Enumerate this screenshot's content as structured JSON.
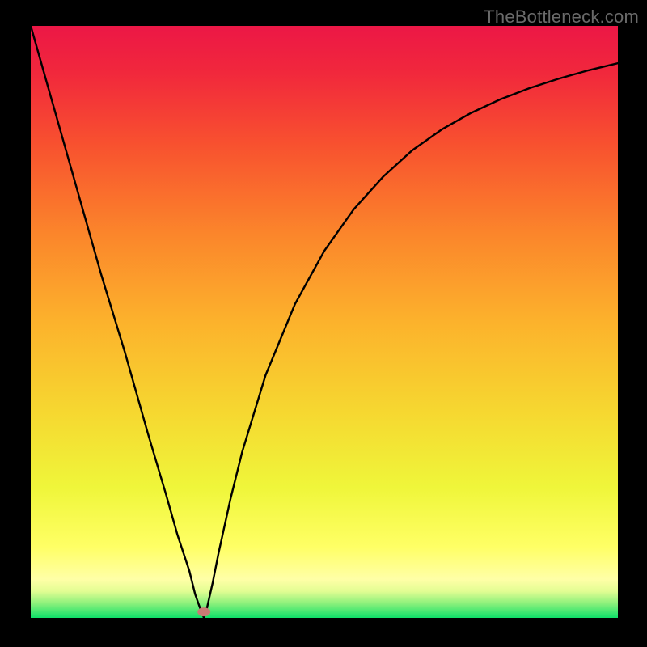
{
  "watermark": "TheBottleneck.com",
  "colors": {
    "bg": "#000000",
    "curve": "#000000",
    "dot": "#c97b74",
    "gradient_stops": [
      {
        "offset": 0.0,
        "color": "#ec1746"
      },
      {
        "offset": 0.08,
        "color": "#f1283c"
      },
      {
        "offset": 0.2,
        "color": "#f8512f"
      },
      {
        "offset": 0.35,
        "color": "#fb852b"
      },
      {
        "offset": 0.5,
        "color": "#fcb22c"
      },
      {
        "offset": 0.65,
        "color": "#f6d730"
      },
      {
        "offset": 0.78,
        "color": "#eff63a"
      },
      {
        "offset": 0.88,
        "color": "#ffff65"
      },
      {
        "offset": 0.935,
        "color": "#ffffa7"
      },
      {
        "offset": 0.955,
        "color": "#e2fd93"
      },
      {
        "offset": 0.975,
        "color": "#8ef17c"
      },
      {
        "offset": 1.0,
        "color": "#0fe069"
      }
    ]
  },
  "plot": {
    "inner_left": 38,
    "inner_top": 32,
    "inner_width": 726,
    "inner_height": 732
  },
  "chart_data": {
    "type": "line",
    "title": "",
    "xlabel": "",
    "ylabel": "",
    "xlim": [
      0,
      100
    ],
    "ylim": [
      0,
      100
    ],
    "minimum_at_x": 29,
    "dot": {
      "x": 29.5,
      "y": 1.0
    },
    "series": [
      {
        "name": "curve",
        "x_pct": [
          0,
          4,
          8,
          12,
          16,
          20,
          23,
          25,
          27,
          28,
          29,
          29.5,
          30,
          31,
          32,
          34,
          36,
          40,
          45,
          50,
          55,
          60,
          65,
          70,
          75,
          80,
          85,
          90,
          95,
          100
        ],
        "y_pct": [
          100,
          86,
          72,
          58,
          45,
          31,
          21,
          14,
          8,
          4,
          1.2,
          0.0,
          1.6,
          6,
          11,
          20,
          28,
          41,
          53,
          62,
          69,
          74.5,
          79,
          82.5,
          85.3,
          87.6,
          89.5,
          91.1,
          92.5,
          93.7
        ]
      }
    ]
  }
}
